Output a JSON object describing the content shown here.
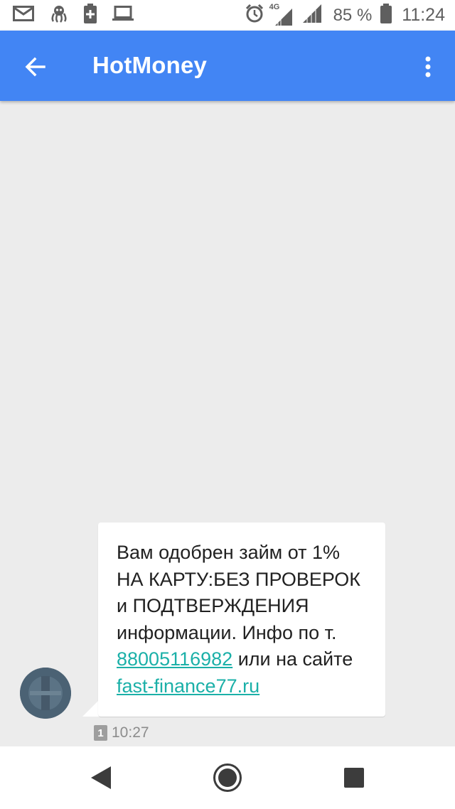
{
  "status_bar": {
    "network": "4G",
    "battery_percent": "85 %",
    "time": "11:24",
    "left_icons": [
      "mail-icon",
      "octopus-icon",
      "battery-saver-icon",
      "laptop-icon"
    ],
    "right_icons": [
      "alarm-icon",
      "signal-icon",
      "signal-icon",
      "battery-icon"
    ]
  },
  "app_bar": {
    "title": "HotMoney",
    "color": "#4285f4"
  },
  "message": {
    "lines": [
      "Вам одобрен займ от 1%",
      "НА КАРТУ:БЕЗ ПРОВЕРОК",
      "и ПОДТВЕРЖДЕНИЯ",
      "информации.  Инфо по т."
    ],
    "phone_link": "88005116982",
    "after_phone": " или на сайте",
    "site_link": "fast-finance77.ru",
    "sim": "1",
    "time": "10:27",
    "link_color": "#1bb0a8"
  },
  "nav_bar": {
    "icons": [
      "back-triangle-icon",
      "home-circle-icon",
      "recents-square-icon"
    ]
  }
}
